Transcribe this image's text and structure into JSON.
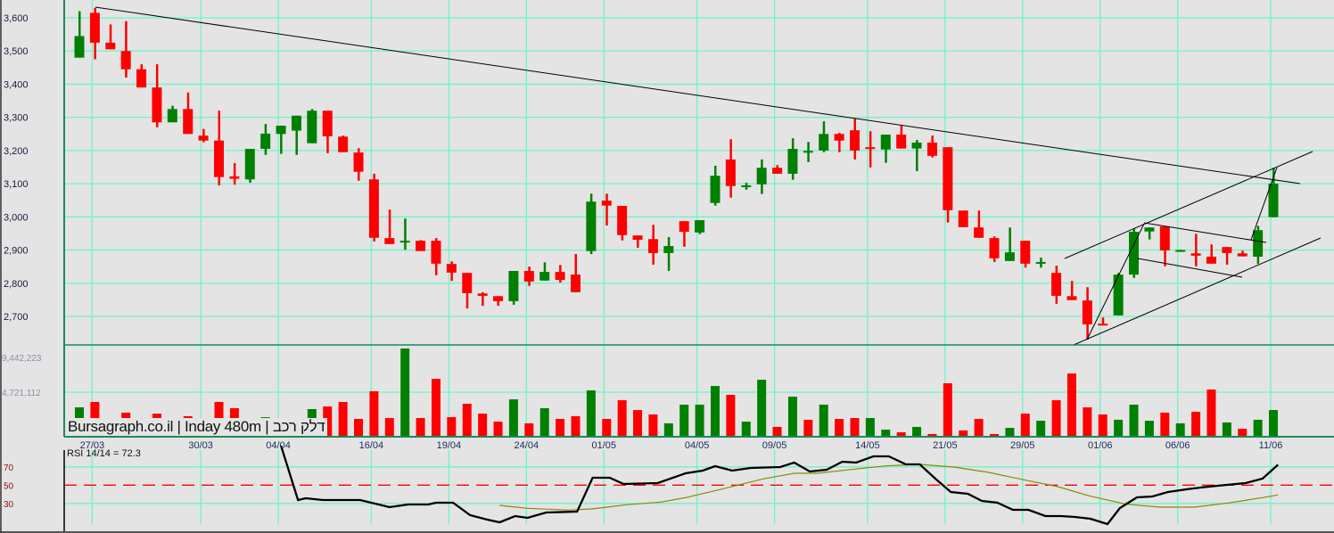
{
  "chart_data": {
    "type": "candlestick",
    "watermark": "Bursagraph.co.il | Inday 480m | דלק רכב",
    "colors": {
      "up": "#008000",
      "down": "#ff0000",
      "grid": "#6ef5c6",
      "border": "#1c8a5c",
      "background": "#e4e4e4",
      "rsi": "#000000",
      "rsi_signal": "#8a8a00",
      "rsi_mid": "#ff0000"
    },
    "price_axis": {
      "ticks": [
        2700,
        2800,
        2900,
        3000,
        3100,
        3200,
        3300,
        3400,
        3500,
        3600
      ],
      "tick_labels": [
        "2,700",
        "2,800",
        "2,900",
        "3,000",
        "3,100",
        "3,200",
        "3,300",
        "3,400",
        "3,500",
        "3,600"
      ]
    },
    "volume_axis": {
      "ticks": [
        4721112,
        9442223
      ],
      "tick_labels": [
        "4,721,112",
        "9,442,223"
      ]
    },
    "x_labels": [
      {
        "index": 2,
        "label": "27/03"
      },
      {
        "index": 9,
        "label": "30/03"
      },
      {
        "index": 14,
        "label": "04/04"
      },
      {
        "index": 20,
        "label": "16/04"
      },
      {
        "index": 25,
        "label": "19/04"
      },
      {
        "index": 30,
        "label": "24/04"
      },
      {
        "index": 35,
        "label": "01/05"
      },
      {
        "index": 41,
        "label": "04/05"
      },
      {
        "index": 46,
        "label": "09/05"
      },
      {
        "index": 52,
        "label": "14/05"
      },
      {
        "index": 57,
        "label": "21/05"
      },
      {
        "index": 62,
        "label": "29/05"
      },
      {
        "index": 67,
        "label": "01/06"
      },
      {
        "index": 72,
        "label": "06/06"
      },
      {
        "index": 78,
        "label": "11/06"
      }
    ],
    "ohlc": [
      [
        3480,
        3620,
        3480,
        3545
      ],
      [
        3615,
        3630,
        3475,
        3525
      ],
      [
        3525,
        3580,
        3505,
        3505
      ],
      [
        3500,
        3590,
        3420,
        3445
      ],
      [
        3445,
        3460,
        3390,
        3390
      ],
      [
        3390,
        3460,
        3270,
        3285
      ],
      [
        3285,
        3335,
        3285,
        3325
      ],
      [
        3325,
        3375,
        3250,
        3250
      ],
      [
        3245,
        3265,
        3225,
        3230
      ],
      [
        3230,
        3320,
        3095,
        3120
      ],
      [
        3122,
        3162,
        3097,
        3115
      ],
      [
        3113,
        3205,
        3103,
        3205
      ],
      [
        3205,
        3280,
        3187,
        3251
      ],
      [
        3250,
        3275,
        3190,
        3275
      ],
      [
        3260,
        3305,
        3187,
        3305
      ],
      [
        3222,
        3325,
        3222,
        3320
      ],
      [
        3320,
        3320,
        3192,
        3243
      ],
      [
        3242,
        3245,
        3195,
        3195
      ],
      [
        3194,
        3207,
        3109,
        3136
      ],
      [
        3113,
        3130,
        2926,
        2937
      ],
      [
        2936,
        3022,
        2918,
        2918
      ],
      [
        2925,
        2995,
        2901,
        2928
      ],
      [
        2928,
        2930,
        2897,
        2897
      ],
      [
        2928,
        2936,
        2824,
        2859
      ],
      [
        2858,
        2866,
        2807,
        2832
      ],
      [
        2831,
        2831,
        2724,
        2770
      ],
      [
        2769,
        2773,
        2732,
        2762
      ],
      [
        2761,
        2761,
        2732,
        2746
      ],
      [
        2746,
        2837,
        2735,
        2837
      ],
      [
        2837,
        2850,
        2792,
        2805
      ],
      [
        2808,
        2863,
        2808,
        2834
      ],
      [
        2834,
        2855,
        2802,
        2810
      ],
      [
        2826,
        2888,
        2773,
        2773
      ],
      [
        2897,
        3070,
        2888,
        3046
      ],
      [
        3049,
        3070,
        2974,
        3034
      ],
      [
        3033,
        3033,
        2929,
        2945
      ],
      [
        2944,
        2944,
        2907,
        2931
      ],
      [
        2933,
        2976,
        2856,
        2891
      ],
      [
        2891,
        2939,
        2837,
        2912
      ],
      [
        2987,
        2987,
        2910,
        2955
      ],
      [
        2953,
        2990,
        2948,
        2990
      ],
      [
        3042,
        3154,
        3034,
        3124
      ],
      [
        3173,
        3234,
        3058,
        3093
      ],
      [
        3094,
        3103,
        3082,
        3095
      ],
      [
        3098,
        3173,
        3069,
        3148
      ],
      [
        3148,
        3156,
        3130,
        3130
      ],
      [
        3130,
        3237,
        3112,
        3205
      ],
      [
        3198,
        3226,
        3165,
        3199
      ],
      [
        3200,
        3288,
        3195,
        3250
      ],
      [
        3250,
        3253,
        3195,
        3230
      ],
      [
        3261,
        3297,
        3173,
        3200
      ],
      [
        3210,
        3258,
        3149,
        3206
      ],
      [
        3203,
        3248,
        3163,
        3248
      ],
      [
        3248,
        3276,
        3206,
        3206
      ],
      [
        3206,
        3232,
        3138,
        3224
      ],
      [
        3224,
        3245,
        3179,
        3184
      ],
      [
        3210,
        3210,
        2983,
        3020
      ],
      [
        3019,
        3019,
        2969,
        2969
      ],
      [
        2968,
        3019,
        2937,
        2937
      ],
      [
        2936,
        2941,
        2864,
        2875
      ],
      [
        2867,
        2968,
        2867,
        2893
      ],
      [
        2928,
        2928,
        2847,
        2859
      ],
      [
        2862,
        2877,
        2847,
        2864
      ],
      [
        2831,
        2853,
        2738,
        2762
      ],
      [
        2761,
        2807,
        2749,
        2749
      ],
      [
        2748,
        2788,
        2630,
        2676
      ],
      [
        2678,
        2697,
        2673,
        2673
      ],
      [
        2703,
        2831,
        2703,
        2826
      ],
      [
        2826,
        2964,
        2816,
        2955
      ],
      [
        2956,
        2968,
        2932,
        2968
      ],
      [
        2971,
        2971,
        2851,
        2899
      ],
      [
        2898,
        2901,
        2896,
        2900
      ],
      [
        2890,
        2949,
        2851,
        2883
      ],
      [
        2880,
        2917,
        2859,
        2859
      ],
      [
        2909,
        2909,
        2856,
        2891
      ],
      [
        2890,
        2898,
        2881,
        2881
      ],
      [
        2880,
        2973,
        2858,
        2960
      ],
      [
        2999,
        3148,
        2999,
        3100
      ]
    ],
    "volume": [
      2960000,
      3520000,
      1200000,
      2410000,
      1000000,
      2310000,
      1100000,
      2040000,
      900000,
      3520000,
      2870000,
      1300000,
      1940000,
      1000000,
      1200000,
      2780000,
      3050000,
      3520000,
      1760000,
      4630000,
      1850000,
      9070000,
      1850000,
      5920000,
      1940000,
      3330000,
      2310000,
      1480000,
      3790000,
      1300000,
      2870000,
      1760000,
      2040000,
      4720000,
      1760000,
      3700000,
      2680000,
      2220000,
      1300000,
      3240000,
      3240000,
      5180000,
      4260000,
      1480000,
      5830000,
      930000,
      4070000,
      1670000,
      3240000,
      1760000,
      1850000,
      1850000,
      650000,
      370000,
      930000,
      190000,
      5460000,
      560000,
      1760000,
      190000,
      830000,
      2310000,
      1570000,
      3700000,
      6480000,
      2960000,
      2220000,
      1670000,
      3240000,
      1570000,
      2410000,
      1300000,
      2500000,
      4810000,
      1390000,
      740000,
      1670000,
      2680000
    ],
    "rsi": {
      "label": "RSI 14/14 = 72.3",
      "levels": [
        70,
        50,
        30
      ],
      "level_labels": [
        "70",
        "50",
        "30"
      ],
      "points": [
        [
          14,
          93.2
        ],
        [
          15.1,
          33.7
        ],
        [
          15.6,
          35.7
        ],
        [
          16.7,
          33.7
        ],
        [
          19.1,
          33.7
        ],
        [
          21,
          25.9
        ],
        [
          22.2,
          28.8
        ],
        [
          23.5,
          28.8
        ],
        [
          24,
          30.8
        ],
        [
          25.1,
          30.8
        ],
        [
          26.2,
          17.1
        ],
        [
          27.3,
          12.2
        ],
        [
          28.1,
          9.3
        ],
        [
          29.1,
          16.1
        ],
        [
          29.9,
          14.2
        ],
        [
          31.1,
          20
        ],
        [
          33.1,
          21
        ],
        [
          34.1,
          58.1
        ],
        [
          35.2,
          58.1
        ],
        [
          36.1,
          51.3
        ],
        [
          38.3,
          52.2
        ],
        [
          40.1,
          63
        ],
        [
          41.2,
          65.9
        ],
        [
          42,
          70.8
        ],
        [
          43.1,
          65.9
        ],
        [
          44.3,
          68.8
        ],
        [
          46.2,
          69.8
        ],
        [
          47.1,
          74.7
        ],
        [
          48.1,
          64.9
        ],
        [
          49.2,
          66.9
        ],
        [
          50.2,
          75.7
        ],
        [
          51.1,
          74.7
        ],
        [
          52.2,
          81.5
        ],
        [
          53.2,
          81.5
        ],
        [
          54.3,
          72.7
        ],
        [
          55.2,
          72.7
        ],
        [
          56.2,
          57.1
        ],
        [
          57.2,
          42.5
        ],
        [
          58.3,
          40.5
        ],
        [
          59.2,
          32.7
        ],
        [
          60.2,
          30.8
        ],
        [
          61.2,
          23
        ],
        [
          62.2,
          23
        ],
        [
          63.3,
          16.1
        ],
        [
          64.3,
          16.1
        ],
        [
          65.2,
          15.2
        ],
        [
          66.2,
          13.2
        ],
        [
          67.3,
          7.4
        ],
        [
          68.1,
          24.9
        ],
        [
          69.2,
          36.6
        ],
        [
          70.2,
          37.6
        ],
        [
          71.2,
          42.5
        ],
        [
          72.4,
          45.4
        ],
        [
          73.3,
          47.4
        ],
        [
          74.4,
          49.3
        ],
        [
          76.2,
          52.2
        ],
        [
          77.3,
          57.1
        ],
        [
          78.3,
          72.3
        ]
      ],
      "signal_points": [
        [
          28.1,
          27.9
        ],
        [
          29.9,
          24.6
        ],
        [
          32.6,
          22.7
        ],
        [
          34.1,
          24
        ],
        [
          36.3,
          28.5
        ],
        [
          38.5,
          31.5
        ],
        [
          40.1,
          36.3
        ],
        [
          42.3,
          45.1
        ],
        [
          45.1,
          56.8
        ],
        [
          47.1,
          63
        ],
        [
          48.6,
          63
        ],
        [
          50.8,
          67.2
        ],
        [
          53,
          71.1
        ],
        [
          55.2,
          72.7
        ],
        [
          57.4,
          69.8
        ],
        [
          59.6,
          64
        ],
        [
          61.9,
          55.9
        ],
        [
          64.1,
          48.3
        ],
        [
          66.2,
          37.9
        ],
        [
          68.5,
          29.1
        ],
        [
          70.7,
          25.9
        ],
        [
          72.9,
          25.9
        ],
        [
          75.1,
          30.5
        ],
        [
          77.3,
          36.3
        ],
        [
          78.3,
          39.3
        ]
      ]
    }
  }
}
